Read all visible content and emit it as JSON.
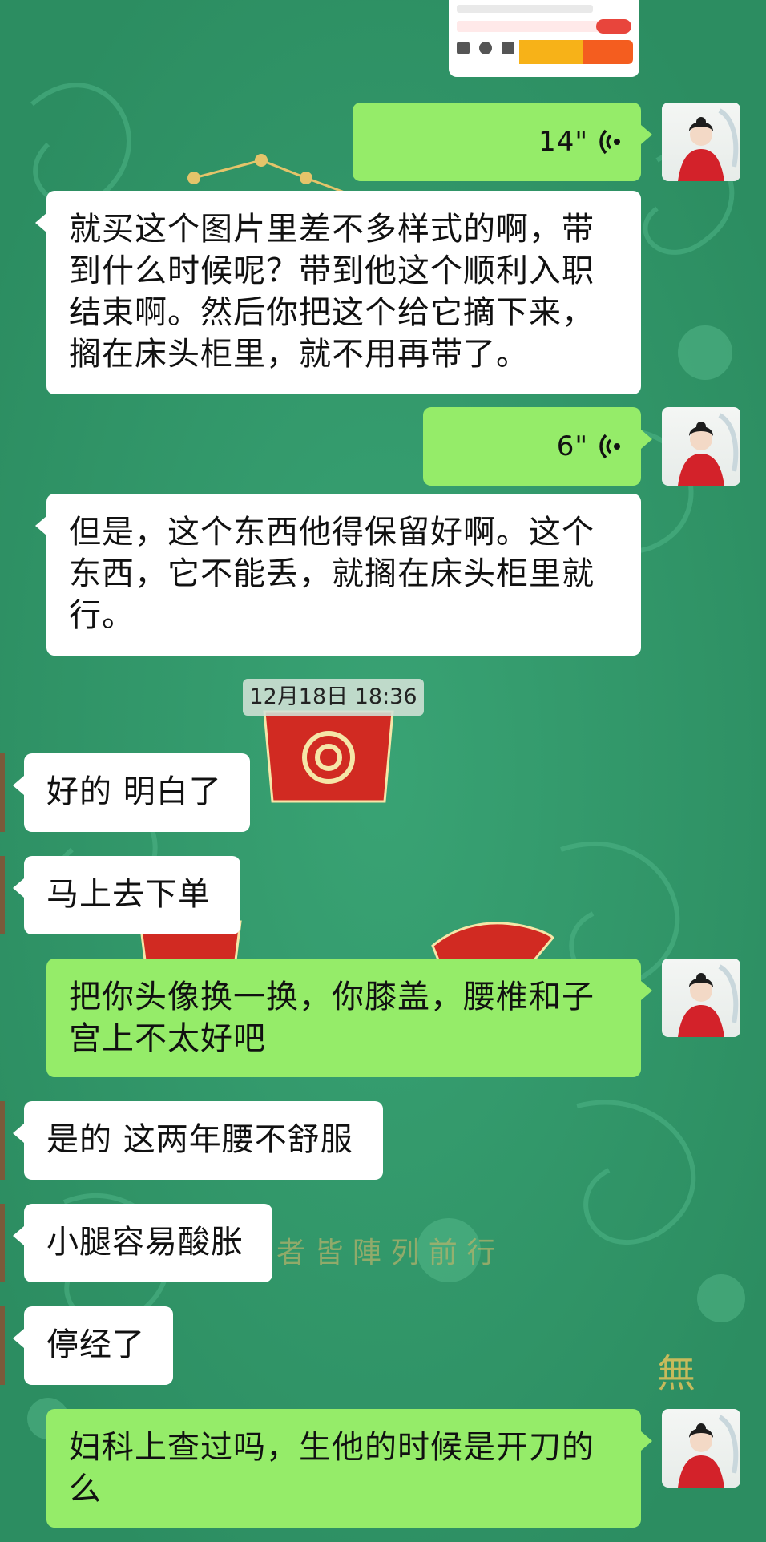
{
  "timestamp": "12月18日 18:36",
  "background": {
    "base_color": "#2f9466",
    "watermark_text": "者 皆 陣 列 前 行",
    "corner_text": "無"
  },
  "colors": {
    "incoming_bubble": "#ffffff",
    "outgoing_bubble": "#95ec69"
  },
  "messages": [
    {
      "id": "m1",
      "from": "me",
      "type": "voice",
      "duration": "14\""
    },
    {
      "id": "m2",
      "from": "me",
      "type": "text",
      "lines": [
        "就买这个图片里差不多样式的啊，带",
        "到什么时候呢？带到他这个顺利入职",
        "结束啊。然后你把这个给它摘下来，",
        "搁在床头柜里，就不用再带了。"
      ]
    },
    {
      "id": "m3",
      "from": "me",
      "type": "voice",
      "duration": "6\""
    },
    {
      "id": "m4",
      "from": "me",
      "type": "text",
      "lines": [
        "但是，这个东西他得保留好啊。这个",
        "东西，它不能丢，就搁在床头柜里就",
        "行。"
      ]
    },
    {
      "id": "m5",
      "from": "other",
      "type": "text",
      "lines": [
        "好的 明白了"
      ]
    },
    {
      "id": "m6",
      "from": "other",
      "type": "text",
      "lines": [
        "马上去下单"
      ]
    },
    {
      "id": "m7",
      "from": "me",
      "type": "text",
      "lines": [
        "把你头像换一换，你膝盖，腰椎和子",
        "宫上不太好吧"
      ]
    },
    {
      "id": "m8",
      "from": "other",
      "type": "text",
      "lines": [
        "是的 这两年腰不舒服"
      ]
    },
    {
      "id": "m9",
      "from": "other",
      "type": "text",
      "lines": [
        "小腿容易酸胀"
      ]
    },
    {
      "id": "m10",
      "from": "other",
      "type": "text",
      "lines": [
        "停经了"
      ]
    },
    {
      "id": "m11",
      "from": "me",
      "type": "text",
      "lines": [
        "妇科上查过吗，生他的时候是开刀的",
        "么"
      ]
    }
  ]
}
